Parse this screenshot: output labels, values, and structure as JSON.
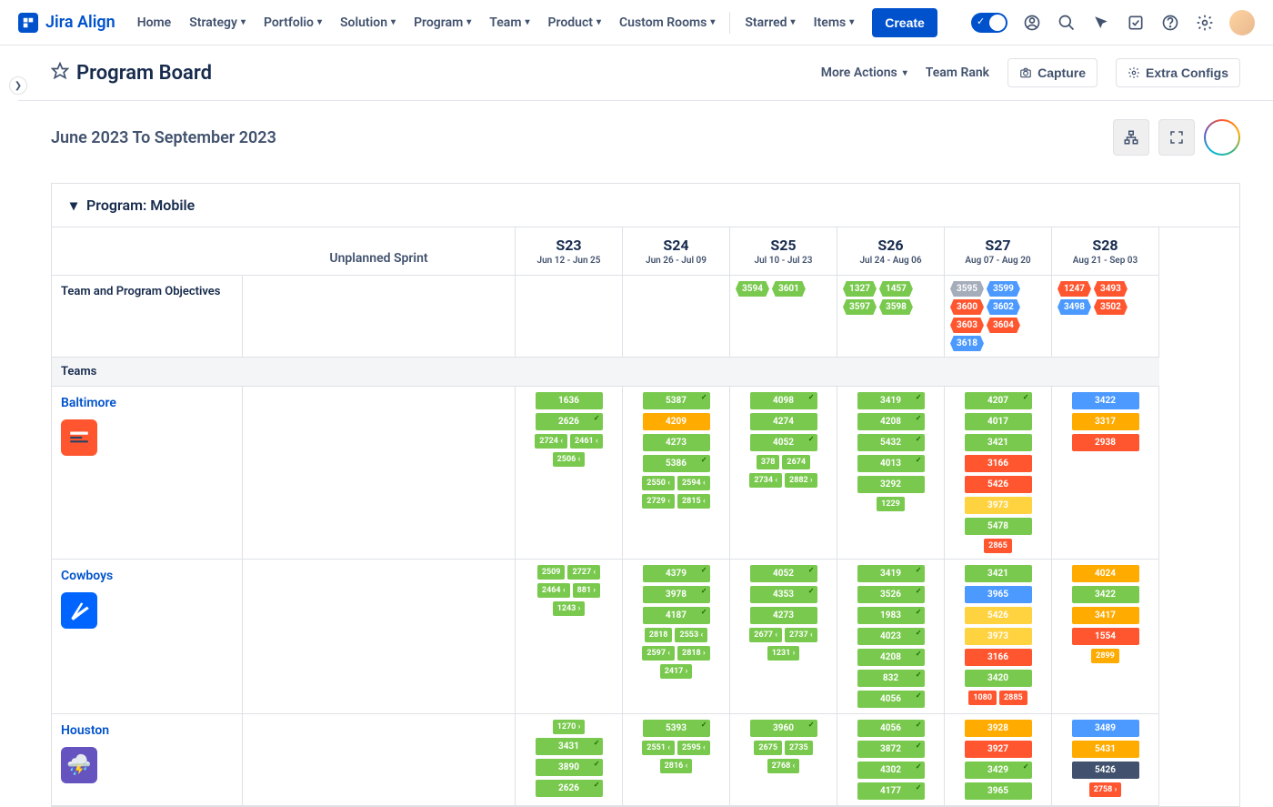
{
  "logo": "Jira Align",
  "nav": {
    "home": "Home",
    "strategy": "Strategy",
    "portfolio": "Portfolio",
    "solution": "Solution",
    "program": "Program",
    "team": "Team",
    "product": "Product",
    "custom_rooms": "Custom Rooms",
    "starred": "Starred",
    "items": "Items",
    "create": "Create"
  },
  "page": {
    "title": "Program Board",
    "more_actions": "More Actions",
    "team_rank": "Team Rank",
    "capture": "Capture",
    "extra_configs": "Extra Configs",
    "date_range": "June 2023 To September 2023",
    "section_title": "Program: Mobile",
    "unplanned": "Unplanned Sprint",
    "objectives_label": "Team and Program Objectives",
    "teams_label": "Teams"
  },
  "sprints": [
    {
      "name": "S23",
      "dates": "Jun 12 - Jun 25"
    },
    {
      "name": "S24",
      "dates": "Jun 26 - Jul 09"
    },
    {
      "name": "S25",
      "dates": "Jul 10 - Jul 23"
    },
    {
      "name": "S26",
      "dates": "Jul 24 - Aug 06"
    },
    {
      "name": "S27",
      "dates": "Aug 07 - Aug 20"
    },
    {
      "name": "S28",
      "dates": "Aug 21 - Sep 03"
    }
  ],
  "objectives": {
    "s25": [
      {
        "id": "3594",
        "c": "green"
      },
      {
        "id": "3601",
        "c": "green"
      }
    ],
    "s26": [
      {
        "id": "1327",
        "c": "green"
      },
      {
        "id": "1457",
        "c": "green"
      },
      {
        "id": "3597",
        "c": "green"
      },
      {
        "id": "3598",
        "c": "green"
      }
    ],
    "s27": [
      {
        "id": "3595",
        "c": "gray"
      },
      {
        "id": "3599",
        "c": "blue"
      },
      {
        "id": "3600",
        "c": "red"
      },
      {
        "id": "3602",
        "c": "blue"
      },
      {
        "id": "3603",
        "c": "red"
      },
      {
        "id": "3604",
        "c": "red"
      },
      {
        "id": "3618",
        "c": "blue"
      }
    ],
    "s28": [
      {
        "id": "1247",
        "c": "red"
      },
      {
        "id": "3493",
        "c": "red"
      },
      {
        "id": "3498",
        "c": "blue"
      },
      {
        "id": "3502",
        "c": "red"
      }
    ]
  },
  "teams": [
    {
      "name": "Baltimore",
      "color": "orange",
      "emoji": "",
      "sprints": [
        [
          {
            "t": "s",
            "id": "1636",
            "c": "green"
          },
          {
            "t": "s",
            "id": "2626",
            "c": "green",
            "ck": true
          },
          {
            "t": "p",
            "ids": [
              "2724 ‹",
              "2461 ‹"
            ],
            "c": "green"
          },
          {
            "t": "p",
            "ids": [
              "2506 ‹"
            ],
            "c": "green"
          }
        ],
        [
          {
            "t": "s",
            "id": "5387",
            "c": "green",
            "ck": true
          },
          {
            "t": "s",
            "id": "4209",
            "c": "orange"
          },
          {
            "t": "s",
            "id": "4273",
            "c": "green"
          },
          {
            "t": "s",
            "id": "5386",
            "c": "green",
            "ck": true
          },
          {
            "t": "p",
            "ids": [
              "2550 ‹",
              "2594 ‹"
            ],
            "c": "green"
          },
          {
            "t": "p",
            "ids": [
              "2729 ‹",
              "2815 ‹"
            ],
            "c": "green"
          }
        ],
        [
          {
            "t": "s",
            "id": "4098",
            "c": "green",
            "ck": true
          },
          {
            "t": "s",
            "id": "4274",
            "c": "green"
          },
          {
            "t": "s",
            "id": "4052",
            "c": "green",
            "ck": true
          },
          {
            "t": "p",
            "ids": [
              "378",
              "2674"
            ],
            "c": "green"
          },
          {
            "t": "p",
            "ids": [
              "2734 ‹",
              "2882 ›"
            ],
            "c": "green"
          }
        ],
        [
          {
            "t": "s",
            "id": "3419",
            "c": "green",
            "ck": true
          },
          {
            "t": "s",
            "id": "4208",
            "c": "green",
            "ck": true
          },
          {
            "t": "s",
            "id": "5432",
            "c": "green",
            "ck": true
          },
          {
            "t": "s",
            "id": "4013",
            "c": "green",
            "ck": true
          },
          {
            "t": "s",
            "id": "3292",
            "c": "green"
          },
          {
            "t": "p",
            "ids": [
              "1229"
            ],
            "c": "green"
          }
        ],
        [
          {
            "t": "s",
            "id": "4207",
            "c": "green",
            "ck": true
          },
          {
            "t": "s",
            "id": "4017",
            "c": "green"
          },
          {
            "t": "s",
            "id": "3421",
            "c": "green"
          },
          {
            "t": "s",
            "id": "3166",
            "c": "red"
          },
          {
            "t": "s",
            "id": "5426",
            "c": "red"
          },
          {
            "t": "s",
            "id": "3973",
            "c": "yellow"
          },
          {
            "t": "s",
            "id": "5478",
            "c": "green"
          },
          {
            "t": "p",
            "ids": [
              "2865"
            ],
            "c": "red"
          }
        ],
        [
          {
            "t": "s",
            "id": "3422",
            "c": "blue"
          },
          {
            "t": "s",
            "id": "3317",
            "c": "orange"
          },
          {
            "t": "s",
            "id": "2938",
            "c": "red"
          }
        ]
      ]
    },
    {
      "name": "Cowboys",
      "color": "blue",
      "emoji": "",
      "sprints": [
        [
          {
            "t": "p",
            "ids": [
              "2509",
              "2727 ‹"
            ],
            "c": "green"
          },
          {
            "t": "p",
            "ids": [
              "2464 ‹",
              "881 ›"
            ],
            "c": "green"
          },
          {
            "t": "p",
            "ids": [
              "1243 ›"
            ],
            "c": "green"
          }
        ],
        [
          {
            "t": "s",
            "id": "4379",
            "c": "green",
            "ck": true
          },
          {
            "t": "s",
            "id": "3978",
            "c": "green",
            "ck": true
          },
          {
            "t": "s",
            "id": "4187",
            "c": "green",
            "ck": true
          },
          {
            "t": "p",
            "ids": [
              "2818",
              "2553 ‹"
            ],
            "c": "green"
          },
          {
            "t": "p",
            "ids": [
              "2597 ‹",
              "2818 ›"
            ],
            "c": "green"
          },
          {
            "t": "p",
            "ids": [
              "2417 ›"
            ],
            "c": "green"
          }
        ],
        [
          {
            "t": "s",
            "id": "4052",
            "c": "green",
            "ck": true
          },
          {
            "t": "s",
            "id": "4353",
            "c": "green",
            "ck": true
          },
          {
            "t": "s",
            "id": "4273",
            "c": "green"
          },
          {
            "t": "p",
            "ids": [
              "2677 ‹",
              "2737 ‹"
            ],
            "c": "green"
          },
          {
            "t": "p",
            "ids": [
              "1231 ›"
            ],
            "c": "green"
          }
        ],
        [
          {
            "t": "s",
            "id": "3419",
            "c": "green",
            "ck": true
          },
          {
            "t": "s",
            "id": "3526",
            "c": "green",
            "ck": true
          },
          {
            "t": "s",
            "id": "1983",
            "c": "green",
            "ck": true
          },
          {
            "t": "s",
            "id": "4023",
            "c": "green",
            "ck": true
          },
          {
            "t": "s",
            "id": "4208",
            "c": "green",
            "ck": true
          },
          {
            "t": "s",
            "id": "832",
            "c": "green",
            "ck": true
          },
          {
            "t": "s",
            "id": "4056",
            "c": "green",
            "ck": true
          }
        ],
        [
          {
            "t": "s",
            "id": "3421",
            "c": "green"
          },
          {
            "t": "s",
            "id": "3965",
            "c": "blue"
          },
          {
            "t": "s",
            "id": "5426",
            "c": "yellow"
          },
          {
            "t": "s",
            "id": "3973",
            "c": "yellow"
          },
          {
            "t": "s",
            "id": "3166",
            "c": "red"
          },
          {
            "t": "s",
            "id": "3420",
            "c": "green"
          },
          {
            "t": "p",
            "ids": [
              "1080",
              "2885"
            ],
            "c": "red"
          }
        ],
        [
          {
            "t": "s",
            "id": "4024",
            "c": "orange"
          },
          {
            "t": "s",
            "id": "3422",
            "c": "green"
          },
          {
            "t": "s",
            "id": "3417",
            "c": "orange"
          },
          {
            "t": "s",
            "id": "1554",
            "c": "red"
          },
          {
            "t": "p",
            "ids": [
              "2899"
            ],
            "c": "orange"
          }
        ]
      ]
    },
    {
      "name": "Houston",
      "color": "purple",
      "emoji": "",
      "sprints": [
        [
          {
            "t": "p",
            "ids": [
              "1270 ›"
            ],
            "c": "green"
          },
          {
            "t": "s",
            "id": "3431",
            "c": "green",
            "ck": true
          },
          {
            "t": "s",
            "id": "3890",
            "c": "green",
            "ck": true
          },
          {
            "t": "s",
            "id": "2626",
            "c": "green",
            "ck": true
          }
        ],
        [
          {
            "t": "s",
            "id": "5393",
            "c": "green",
            "ck": true
          },
          {
            "t": "p",
            "ids": [
              "2551 ‹",
              "2595 ‹"
            ],
            "c": "green"
          },
          {
            "t": "p",
            "ids": [
              "2816 ‹"
            ],
            "c": "green"
          }
        ],
        [
          {
            "t": "s",
            "id": "3960",
            "c": "green",
            "ck": true
          },
          {
            "t": "p",
            "ids": [
              "2675",
              "2735"
            ],
            "c": "green"
          },
          {
            "t": "p",
            "ids": [
              "2768 ‹"
            ],
            "c": "green"
          }
        ],
        [
          {
            "t": "s",
            "id": "4056",
            "c": "green",
            "ck": true
          },
          {
            "t": "s",
            "id": "3872",
            "c": "green",
            "ck": true
          },
          {
            "t": "s",
            "id": "4302",
            "c": "green",
            "ck": true
          },
          {
            "t": "s",
            "id": "4177",
            "c": "green",
            "ck": true
          }
        ],
        [
          {
            "t": "s",
            "id": "3928",
            "c": "orange"
          },
          {
            "t": "s",
            "id": "3927",
            "c": "red"
          },
          {
            "t": "s",
            "id": "3429",
            "c": "green",
            "ck": true
          },
          {
            "t": "s",
            "id": "3965",
            "c": "green"
          }
        ],
        [
          {
            "t": "s",
            "id": "3489",
            "c": "blue"
          },
          {
            "t": "s",
            "id": "5431",
            "c": "orange"
          },
          {
            "t": "s",
            "id": "5426",
            "c": "dark"
          },
          {
            "t": "p",
            "ids": [
              "2758 ›"
            ],
            "c": "red"
          }
        ]
      ]
    }
  ]
}
